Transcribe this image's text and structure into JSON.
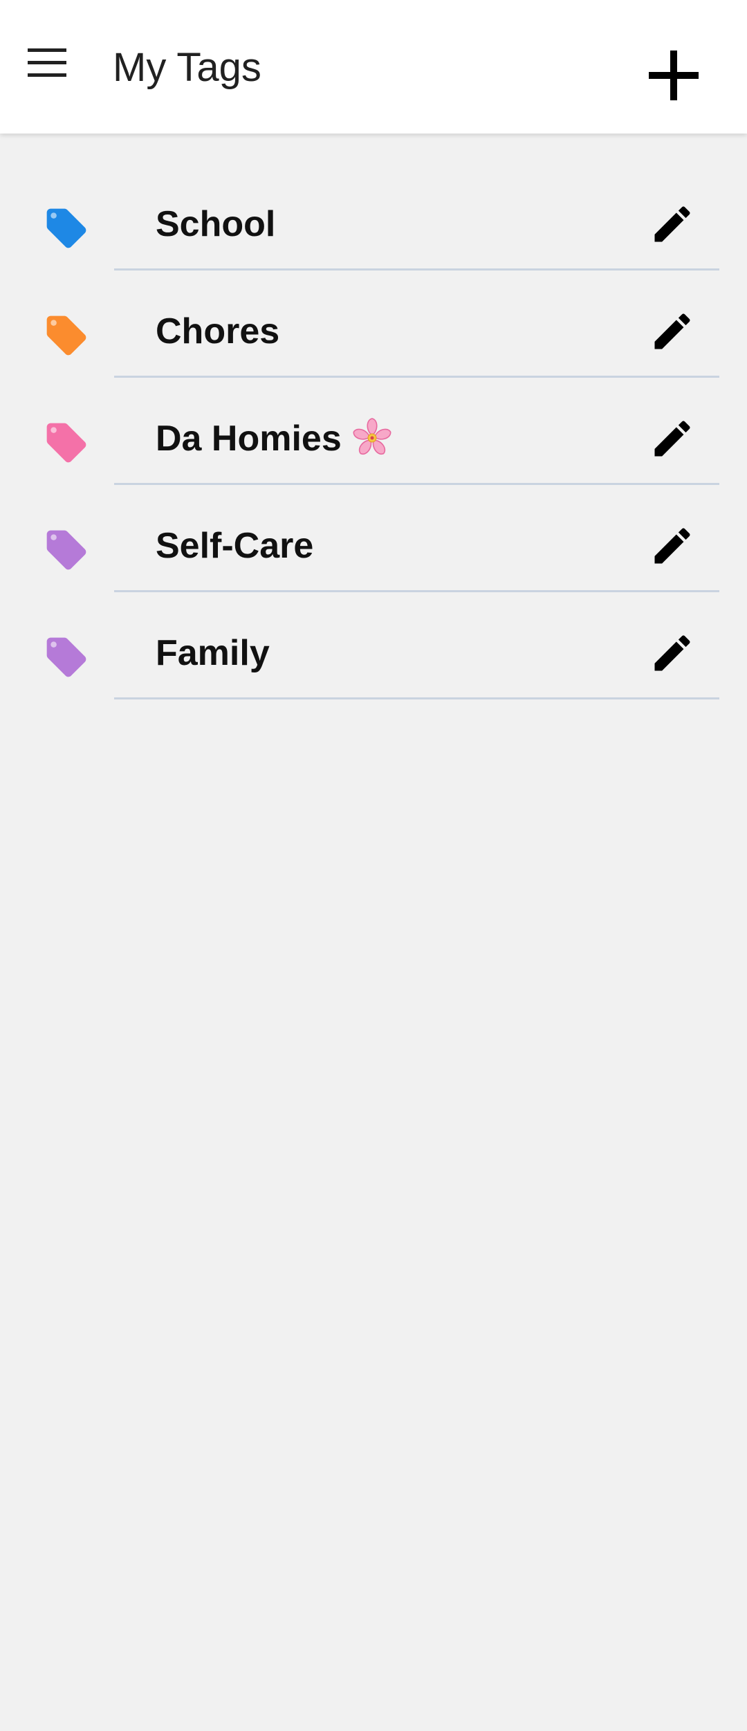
{
  "header": {
    "title": "My Tags",
    "menu_icon": "hamburger-menu-icon",
    "add_icon": "plus-icon"
  },
  "tags": [
    {
      "label": "School",
      "color": "#1e88e5",
      "icon": "tag-icon",
      "edit_icon": "pencil-icon"
    },
    {
      "label": "Chores",
      "color": "#fb8c2e",
      "icon": "tag-icon",
      "edit_icon": "pencil-icon"
    },
    {
      "label": "Da Homies",
      "emoji": "cherry-blossom",
      "color": "#f471a8",
      "icon": "tag-icon",
      "edit_icon": "pencil-icon"
    },
    {
      "label": "Self-Care",
      "color": "#b57ad8",
      "icon": "tag-icon",
      "edit_icon": "pencil-icon"
    },
    {
      "label": "Family",
      "color": "#b57ad8",
      "icon": "tag-icon",
      "edit_icon": "pencil-icon"
    }
  ],
  "theme": {
    "app_bar_bg": "#ffffff",
    "page_bg": "#f1f1f1",
    "divider": "#c9d3e0",
    "text": "#111111"
  }
}
